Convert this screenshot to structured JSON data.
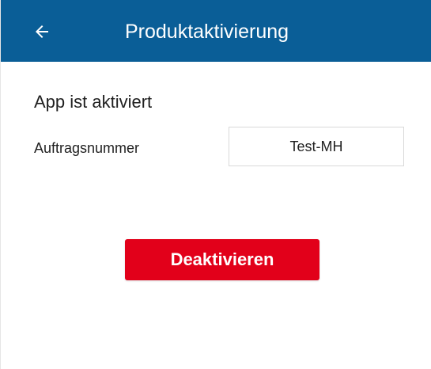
{
  "app_bar": {
    "title": "Produktaktivierung",
    "back_icon": "arrow-left-icon",
    "color": "#0a5e97"
  },
  "content": {
    "status_text": "App ist aktiviert",
    "order_number": {
      "label": "Auftragsnummer",
      "value": "Test-MH"
    },
    "deactivate_button": {
      "label": "Deaktivieren",
      "color": "#e2001a"
    }
  }
}
